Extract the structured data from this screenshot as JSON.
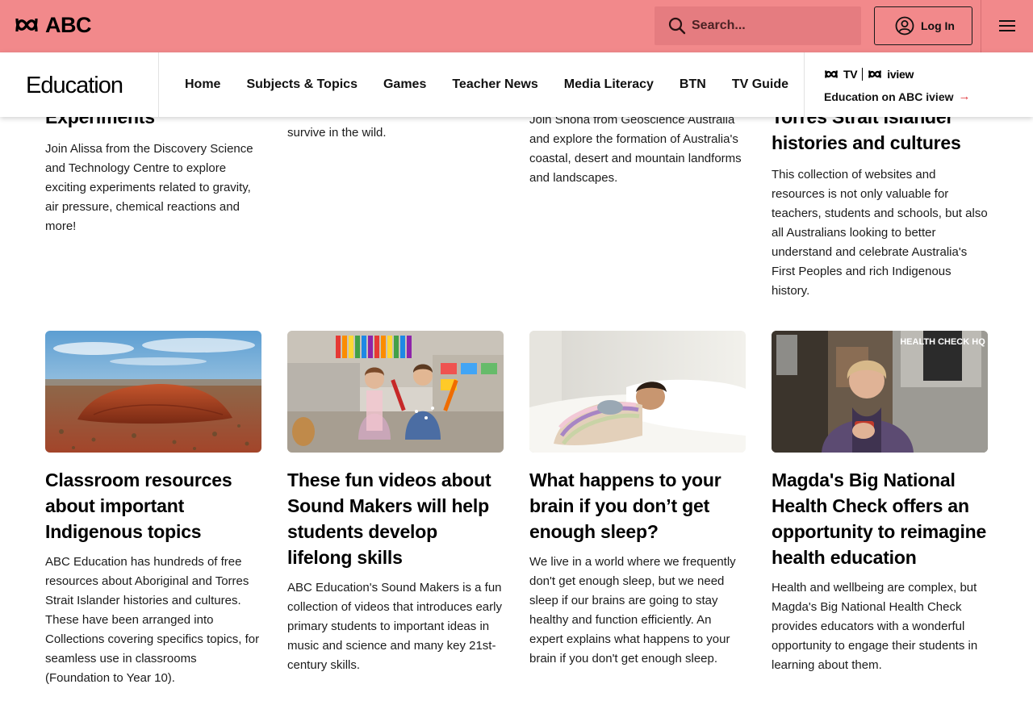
{
  "header": {
    "logo_text": "ABC",
    "search_placeholder": "Search...",
    "login_label": "Log In"
  },
  "nav": {
    "title": "Education",
    "links": [
      "Home",
      "Subjects & Topics",
      "Games",
      "Teacher News",
      "Media Literacy",
      "BTN",
      "TV Guide"
    ],
    "iview_tv": "TV",
    "iview_iv": "iview",
    "iview_link": "Education on ABC iview"
  },
  "top_cards": [
    {
      "title_tail": "Experiments",
      "desc": "Join Alissa from the Discovery Science and Technology Centre to explore exciting experiments related to gravity, air pressure, chemical reactions and more!"
    },
    {
      "desc": "survive in the wild."
    },
    {
      "desc": "Join Shona from Geoscience Australia and explore the formation of Australia's coastal, desert and mountain landforms and landscapes."
    },
    {
      "title_tail": "Torres Strait Islander histories and cultures",
      "desc": "This collection of websites and resources is not only valuable for teachers, students and schools, but also all Australians looking to better understand and celebrate Australia's First Peoples and rich Indigenous history."
    }
  ],
  "cards": [
    {
      "title": "Classroom resources about important Indigenous topics",
      "desc": "ABC Education has hundreds of free resources about Aboriginal and Torres Strait Islander histories and cultures. These have been arranged into Collections covering specifics topics, for seamless use in classrooms (Foundation to Year 10)."
    },
    {
      "title": "These fun videos about Sound Makers will help students develop lifelong skills",
      "desc": "ABC Education's Sound Makers is a fun collection of videos that introduces early primary students to important ideas in music and science and many key 21st-century skills."
    },
    {
      "title": "What happens to your brain if you don’t get enough sleep?",
      "desc": "We live in a world where we frequently don't get enough sleep, but we need sleep if our brains are going to stay healthy and function efficiently. An expert explains what happens to your brain if you don't get enough sleep."
    },
    {
      "title": "Magda's Big National Health Check offers an opportunity to reimagine health education",
      "desc": "Health and wellbeing are complex, but Magda's Big National Health Check provides educators with a wonderful opportunity to engage their students in learning about them.",
      "image_sign": "HEALTH CHECK HQ"
    }
  ]
}
